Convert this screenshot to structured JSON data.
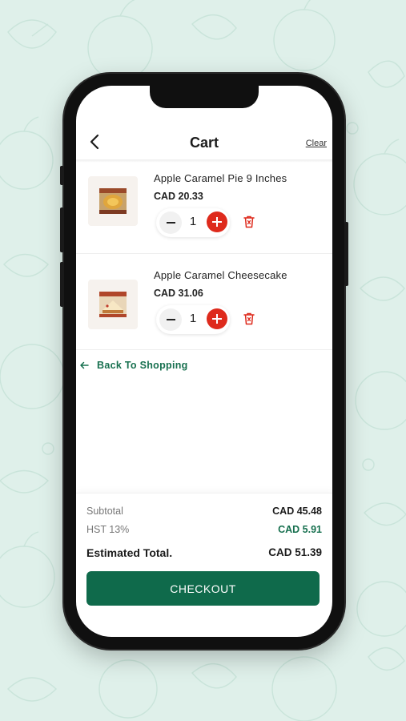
{
  "header": {
    "title": "Cart",
    "clear_label": "Clear"
  },
  "cart": {
    "items": [
      {
        "name": "Apple Caramel Pie 9 Inches",
        "price": "CAD 20.33",
        "quantity": "1",
        "image": "pie-box-image"
      },
      {
        "name": "Apple Caramel Cheesecake",
        "price": "CAD 31.06",
        "quantity": "1",
        "image": "cheesecake-box-image"
      }
    ],
    "back_to_shopping_label": "Back To Shopping"
  },
  "summary": {
    "subtotal_label": "Subtotal",
    "subtotal_value": "CAD 45.48",
    "tax_label": "HST 13%",
    "tax_value": "CAD 5.91",
    "total_label": "Estimated Total.",
    "total_value": "CAD 51.39",
    "checkout_label": "CHECKOUT"
  },
  "colors": {
    "background": "#dff0ea",
    "brand_green": "#0f6a4b",
    "accent_red": "#de2a1c"
  }
}
